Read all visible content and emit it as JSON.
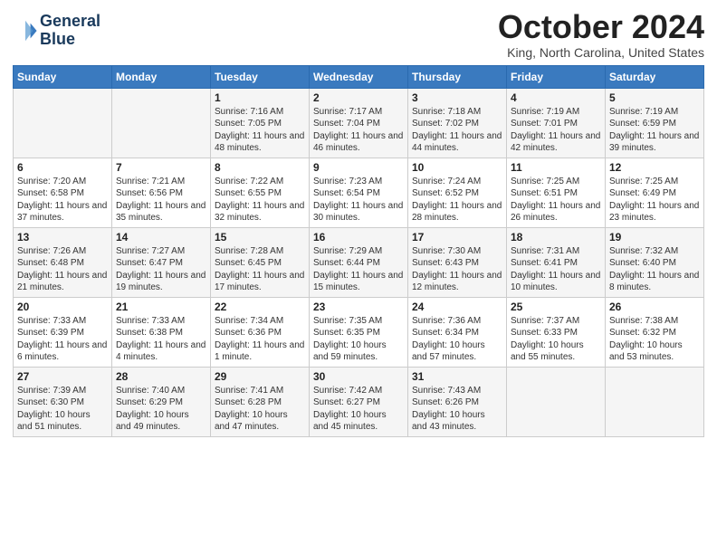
{
  "logo": {
    "line1": "General",
    "line2": "Blue"
  },
  "title": "October 2024",
  "location": "King, North Carolina, United States",
  "days_of_week": [
    "Sunday",
    "Monday",
    "Tuesday",
    "Wednesday",
    "Thursday",
    "Friday",
    "Saturday"
  ],
  "weeks": [
    [
      {
        "day": "",
        "sunrise": "",
        "sunset": "",
        "daylight": ""
      },
      {
        "day": "",
        "sunrise": "",
        "sunset": "",
        "daylight": ""
      },
      {
        "day": "1",
        "sunrise": "Sunrise: 7:16 AM",
        "sunset": "Sunset: 7:05 PM",
        "daylight": "Daylight: 11 hours and 48 minutes."
      },
      {
        "day": "2",
        "sunrise": "Sunrise: 7:17 AM",
        "sunset": "Sunset: 7:04 PM",
        "daylight": "Daylight: 11 hours and 46 minutes."
      },
      {
        "day": "3",
        "sunrise": "Sunrise: 7:18 AM",
        "sunset": "Sunset: 7:02 PM",
        "daylight": "Daylight: 11 hours and 44 minutes."
      },
      {
        "day": "4",
        "sunrise": "Sunrise: 7:19 AM",
        "sunset": "Sunset: 7:01 PM",
        "daylight": "Daylight: 11 hours and 42 minutes."
      },
      {
        "day": "5",
        "sunrise": "Sunrise: 7:19 AM",
        "sunset": "Sunset: 6:59 PM",
        "daylight": "Daylight: 11 hours and 39 minutes."
      }
    ],
    [
      {
        "day": "6",
        "sunrise": "Sunrise: 7:20 AM",
        "sunset": "Sunset: 6:58 PM",
        "daylight": "Daylight: 11 hours and 37 minutes."
      },
      {
        "day": "7",
        "sunrise": "Sunrise: 7:21 AM",
        "sunset": "Sunset: 6:56 PM",
        "daylight": "Daylight: 11 hours and 35 minutes."
      },
      {
        "day": "8",
        "sunrise": "Sunrise: 7:22 AM",
        "sunset": "Sunset: 6:55 PM",
        "daylight": "Daylight: 11 hours and 32 minutes."
      },
      {
        "day": "9",
        "sunrise": "Sunrise: 7:23 AM",
        "sunset": "Sunset: 6:54 PM",
        "daylight": "Daylight: 11 hours and 30 minutes."
      },
      {
        "day": "10",
        "sunrise": "Sunrise: 7:24 AM",
        "sunset": "Sunset: 6:52 PM",
        "daylight": "Daylight: 11 hours and 28 minutes."
      },
      {
        "day": "11",
        "sunrise": "Sunrise: 7:25 AM",
        "sunset": "Sunset: 6:51 PM",
        "daylight": "Daylight: 11 hours and 26 minutes."
      },
      {
        "day": "12",
        "sunrise": "Sunrise: 7:25 AM",
        "sunset": "Sunset: 6:49 PM",
        "daylight": "Daylight: 11 hours and 23 minutes."
      }
    ],
    [
      {
        "day": "13",
        "sunrise": "Sunrise: 7:26 AM",
        "sunset": "Sunset: 6:48 PM",
        "daylight": "Daylight: 11 hours and 21 minutes."
      },
      {
        "day": "14",
        "sunrise": "Sunrise: 7:27 AM",
        "sunset": "Sunset: 6:47 PM",
        "daylight": "Daylight: 11 hours and 19 minutes."
      },
      {
        "day": "15",
        "sunrise": "Sunrise: 7:28 AM",
        "sunset": "Sunset: 6:45 PM",
        "daylight": "Daylight: 11 hours and 17 minutes."
      },
      {
        "day": "16",
        "sunrise": "Sunrise: 7:29 AM",
        "sunset": "Sunset: 6:44 PM",
        "daylight": "Daylight: 11 hours and 15 minutes."
      },
      {
        "day": "17",
        "sunrise": "Sunrise: 7:30 AM",
        "sunset": "Sunset: 6:43 PM",
        "daylight": "Daylight: 11 hours and 12 minutes."
      },
      {
        "day": "18",
        "sunrise": "Sunrise: 7:31 AM",
        "sunset": "Sunset: 6:41 PM",
        "daylight": "Daylight: 11 hours and 10 minutes."
      },
      {
        "day": "19",
        "sunrise": "Sunrise: 7:32 AM",
        "sunset": "Sunset: 6:40 PM",
        "daylight": "Daylight: 11 hours and 8 minutes."
      }
    ],
    [
      {
        "day": "20",
        "sunrise": "Sunrise: 7:33 AM",
        "sunset": "Sunset: 6:39 PM",
        "daylight": "Daylight: 11 hours and 6 minutes."
      },
      {
        "day": "21",
        "sunrise": "Sunrise: 7:33 AM",
        "sunset": "Sunset: 6:38 PM",
        "daylight": "Daylight: 11 hours and 4 minutes."
      },
      {
        "day": "22",
        "sunrise": "Sunrise: 7:34 AM",
        "sunset": "Sunset: 6:36 PM",
        "daylight": "Daylight: 11 hours and 1 minute."
      },
      {
        "day": "23",
        "sunrise": "Sunrise: 7:35 AM",
        "sunset": "Sunset: 6:35 PM",
        "daylight": "Daylight: 10 hours and 59 minutes."
      },
      {
        "day": "24",
        "sunrise": "Sunrise: 7:36 AM",
        "sunset": "Sunset: 6:34 PM",
        "daylight": "Daylight: 10 hours and 57 minutes."
      },
      {
        "day": "25",
        "sunrise": "Sunrise: 7:37 AM",
        "sunset": "Sunset: 6:33 PM",
        "daylight": "Daylight: 10 hours and 55 minutes."
      },
      {
        "day": "26",
        "sunrise": "Sunrise: 7:38 AM",
        "sunset": "Sunset: 6:32 PM",
        "daylight": "Daylight: 10 hours and 53 minutes."
      }
    ],
    [
      {
        "day": "27",
        "sunrise": "Sunrise: 7:39 AM",
        "sunset": "Sunset: 6:30 PM",
        "daylight": "Daylight: 10 hours and 51 minutes."
      },
      {
        "day": "28",
        "sunrise": "Sunrise: 7:40 AM",
        "sunset": "Sunset: 6:29 PM",
        "daylight": "Daylight: 10 hours and 49 minutes."
      },
      {
        "day": "29",
        "sunrise": "Sunrise: 7:41 AM",
        "sunset": "Sunset: 6:28 PM",
        "daylight": "Daylight: 10 hours and 47 minutes."
      },
      {
        "day": "30",
        "sunrise": "Sunrise: 7:42 AM",
        "sunset": "Sunset: 6:27 PM",
        "daylight": "Daylight: 10 hours and 45 minutes."
      },
      {
        "day": "31",
        "sunrise": "Sunrise: 7:43 AM",
        "sunset": "Sunset: 6:26 PM",
        "daylight": "Daylight: 10 hours and 43 minutes."
      },
      {
        "day": "",
        "sunrise": "",
        "sunset": "",
        "daylight": ""
      },
      {
        "day": "",
        "sunrise": "",
        "sunset": "",
        "daylight": ""
      }
    ]
  ]
}
